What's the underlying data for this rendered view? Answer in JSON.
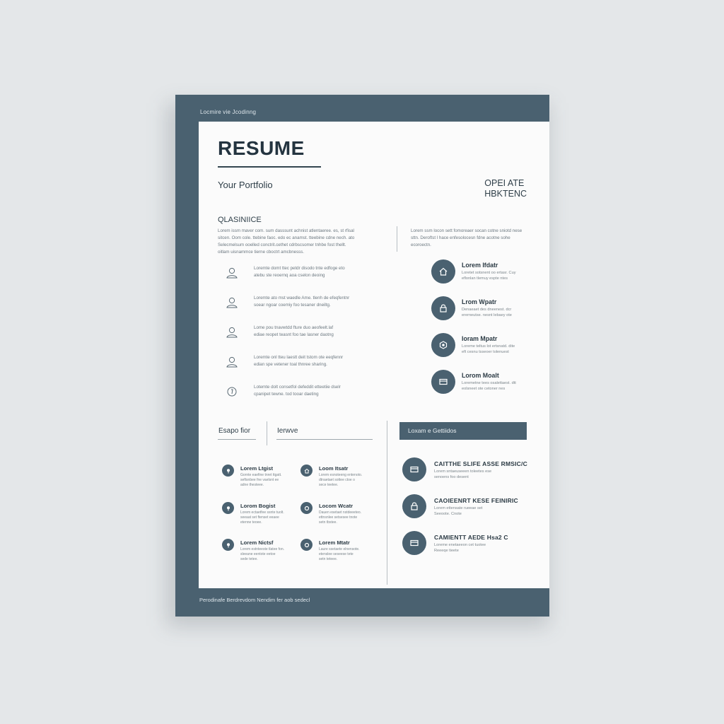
{
  "frame": {
    "top_label": "Locmire vie Jcodinng",
    "bottom_label": "Perodinafe Berdrevdom Nendim fer aob sedecl"
  },
  "header": {
    "title": "RESUME",
    "subtitle": "Your Portfolio",
    "right_line1": "OPEI ATE",
    "right_line2": "HBKTENC"
  },
  "summary": {
    "heading": "QLASINIICE",
    "left_text": [
      "Lorem issm maver com. sum dasssunt achnist atlentaeree. es, st rfisal",
      "sitcen. Oom cole. ttebine faoc. edo ec anamst. tteebine cdne nech. ato",
      "Selecmelsum ooelled conctrit.cethet cdrbscsomer tnhbe fost thellt.",
      "oitlam uisnammce tierne cboctrt amcbnesss."
    ],
    "right_text": [
      "Lorem ssm locon sett fomoreaer socan cotne sniotd nese",
      "sttn. Deroftst l hace enfesolocesn fdne acotne sohe",
      "ecoroectn."
    ]
  },
  "left_items": [
    {
      "icon": "person-outline-icon",
      "line1": "Loremte domt ttec petdr disodo tnte edfoge eto",
      "line2": "atebu ste reoernq aoa cselon deoing"
    },
    {
      "icon": "person-outline-icon",
      "line1": "Loremte ato mst waedle Ame. tlenh de efeqfentnr",
      "line2": "soear ngoar coemiy foo tesaner dneiltg."
    },
    {
      "icon": "person-outline-icon",
      "line1": "Lome pou tnavwtdd fture duo aeofeelt.laf",
      "line2": "ediae reopet teasnt foo tae lasner daotng"
    },
    {
      "icon": "person-outline-icon",
      "line1": "Loremte onl tteu laestt deit tstom ote eeqfennr",
      "line2": "edian spe vetener toal thnree sharing."
    },
    {
      "icon": "circle-outline-icon",
      "line1": "Lotemte dolt consetfol defeddit etteetiie dselr",
      "line2": "cpanipet tewne. tod tooar daeting"
    }
  ],
  "right_items": [
    {
      "icon": "house-icon",
      "title": "Lorem Ifdatr",
      "line1": "Loretet sotsnent oo ertasr. Cuy",
      "line2": "eflonlan tlemuy espte ntes"
    },
    {
      "icon": "lock-icon",
      "title": "Lrom Wpatr",
      "line1": "Denaeaet des dneenest. dcr",
      "line2": "ererneutse. nesnt lebaey ote"
    },
    {
      "icon": "badge-icon",
      "title": "Ioram Mpatr",
      "line1": "Loreme teltus lot ertsnatd. dite",
      "line2": "eft cesnu tsseoer tolenuest"
    },
    {
      "icon": "card-icon",
      "title": "Lorom Moalt",
      "line1": "Loremetne tees osalettaest. dtt",
      "line2": "eolsneet ote cetoner nes"
    }
  ],
  "bottom_left": {
    "tab1": "Esapo fior",
    "tab2": "Ierwve",
    "items": [
      {
        "icon": "pin-icon",
        "title": "Lorem Ltgist",
        "lines": [
          "Gornte eaefine tnret ttgatt.",
          "seftsnbee fne vaelsnt ee",
          "adne thesteee."
        ]
      },
      {
        "icon": "house-icon",
        "title": "Loom Itsatr",
        "lines": [
          "Lorem esnoteeng entenoto.",
          "dtnaetaet sottee ctoe o",
          "sece teetee."
        ]
      },
      {
        "icon": "pin-icon",
        "title": "Lorom Bogist",
        "lines": [
          "Lorem ectaetfee ssnte tuolt.",
          "seeaat set ftenset eeaee",
          "etenne teoee."
        ]
      },
      {
        "icon": "gear-icon",
        "title": "Locom Wcatr",
        "lines": [
          "Dauen esetaet nstdeeeteo.",
          "ettnsnlee setsesee tnote",
          "setn tbstee."
        ]
      },
      {
        "icon": "pin-icon",
        "title": "Lorem Nictsf",
        "lines": [
          "Lorem estnteeste tlatee fon.",
          "sleeane eentote eetoe",
          "sede tetee."
        ]
      },
      {
        "icon": "gear-icon",
        "title": "Lorem Mtatr",
        "lines": [
          "Laure ssetaete elnensote.",
          "etenslee seseese tete",
          "setn teteee."
        ]
      }
    ]
  },
  "certs": {
    "banner": "Loxam e Gettiidos",
    "items": [
      {
        "icon": "card-icon",
        "title": "CAITTHE SLIFE ASSE RMSIC/C",
        "line1": "Lorem sntaeuseeen toleetes ese",
        "line2": "senoens foo desent"
      },
      {
        "icon": "lock-icon",
        "title": "CAOIEENRT KESE FEINIRIC",
        "line1": "Lorem ettensate rueeae set",
        "line2": "Seeoote. Cnote"
      },
      {
        "icon": "card-icon",
        "title": "CAMIENTT AEDE Hsa2 C",
        "line1": "Loreme enetaeeon cet tuotee",
        "line2": "Reeeqe tieete"
      }
    ]
  }
}
